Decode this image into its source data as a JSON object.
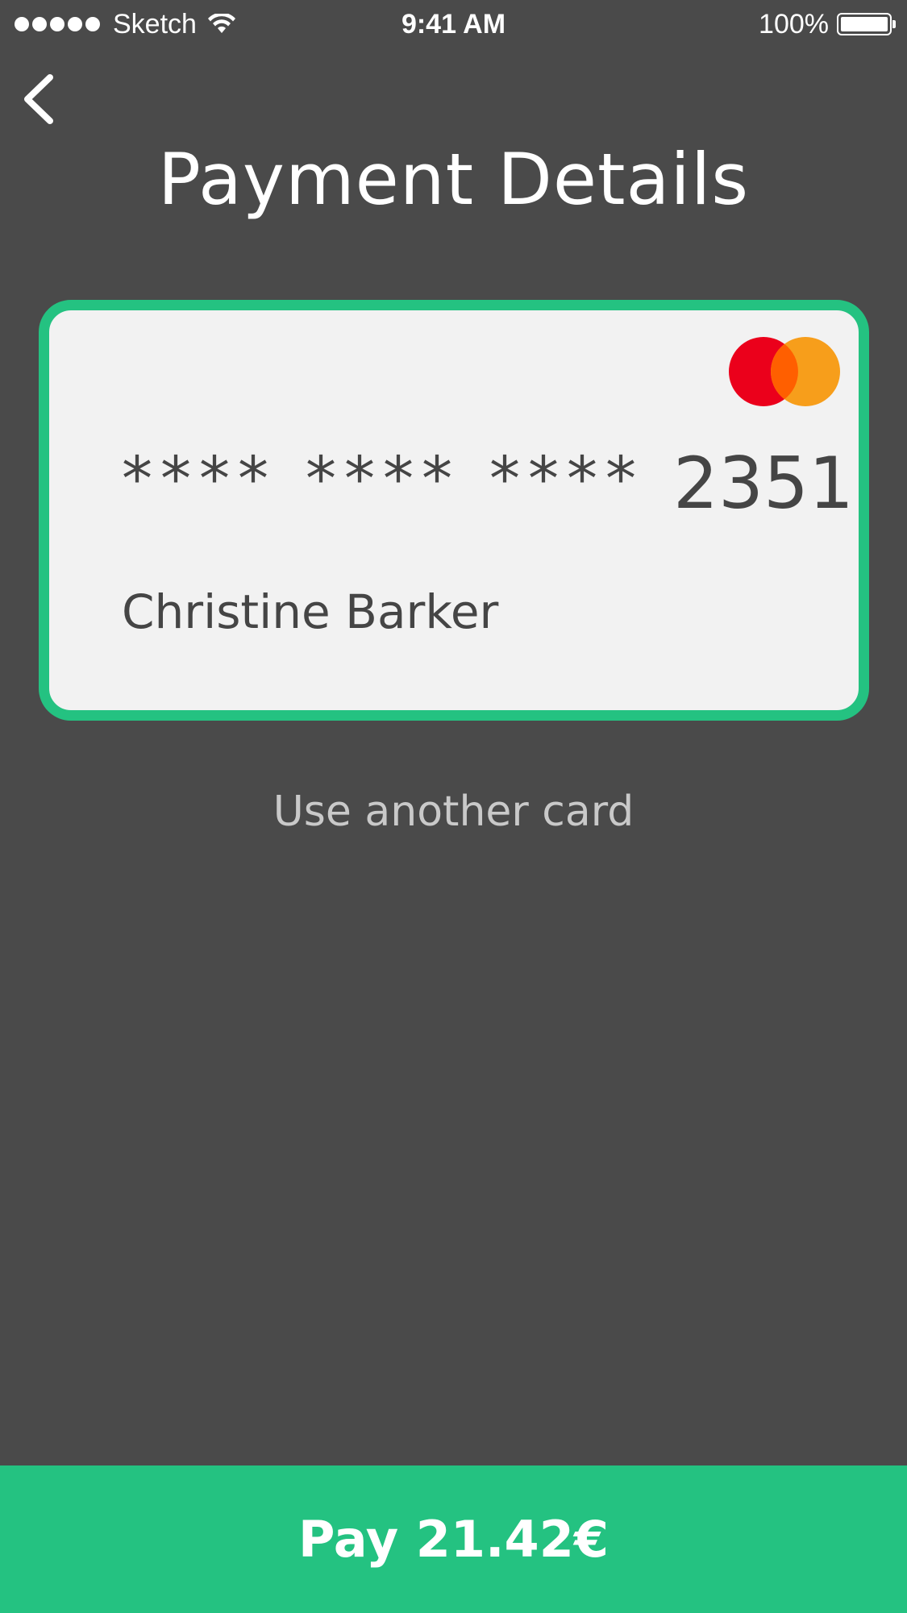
{
  "status_bar": {
    "carrier": "Sketch",
    "time": "9:41 AM",
    "battery": "100%",
    "signal_icon": "signal-dots-icon",
    "wifi_icon": "wifi-icon",
    "battery_icon": "battery-icon"
  },
  "header": {
    "back_icon": "chevron-left-icon",
    "title": "Payment Details"
  },
  "card": {
    "number_masked_groups": [
      "****",
      "****",
      "****"
    ],
    "last_four": "2351",
    "holder": "Christine Barker",
    "brand_icon": "mastercard-logo",
    "border_color": "#24c281"
  },
  "use_another_card": "Use another card",
  "pay_button": {
    "label": "Pay 21.42€",
    "color": "#24c281"
  },
  "colors": {
    "background": "#4a4a4a",
    "accent": "#24c281",
    "card_background": "#f2f2f2",
    "card_text": "#454545",
    "mastercard_red": "#eb001b",
    "mastercard_orange": "#f79e1b",
    "mastercard_overlap": "#ff5f00"
  }
}
